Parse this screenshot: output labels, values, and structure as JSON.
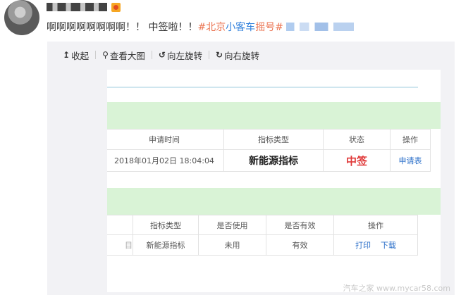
{
  "post": {
    "username_blurred": "user-name",
    "text_main": "啊啊啊啊啊啊啊啊！！ 中签啦！！",
    "topic_part1": "#北京",
    "topic_part2": "小客车",
    "topic_part3": "摇号#"
  },
  "toolbar": {
    "collapse": "收起",
    "view_large": "查看大图",
    "rotate_left": "向左旋转",
    "rotate_right": "向右旋转"
  },
  "table1": {
    "headers": [
      "申请时间",
      "指标类型",
      "状态",
      "操作"
    ],
    "row": {
      "time": "2018年01月02日 18:04:04",
      "type": "新能源指标",
      "status": "中签",
      "action": "申请表"
    }
  },
  "table2": {
    "headers": [
      "指标类型",
      "是否使用",
      "是否有效",
      "操作"
    ],
    "row": {
      "left_fragment": "目",
      "type": "新能源指标",
      "used": "未用",
      "valid": "有效",
      "print": "打印",
      "download": "下载"
    }
  },
  "watermark": "汽车之家 www.mycar58.com",
  "colors": {
    "green_band": "#d9f3d6",
    "status_red": "#e03a3a",
    "link_blue": "#2b6fc9",
    "topic_orange": "#eb7350"
  }
}
